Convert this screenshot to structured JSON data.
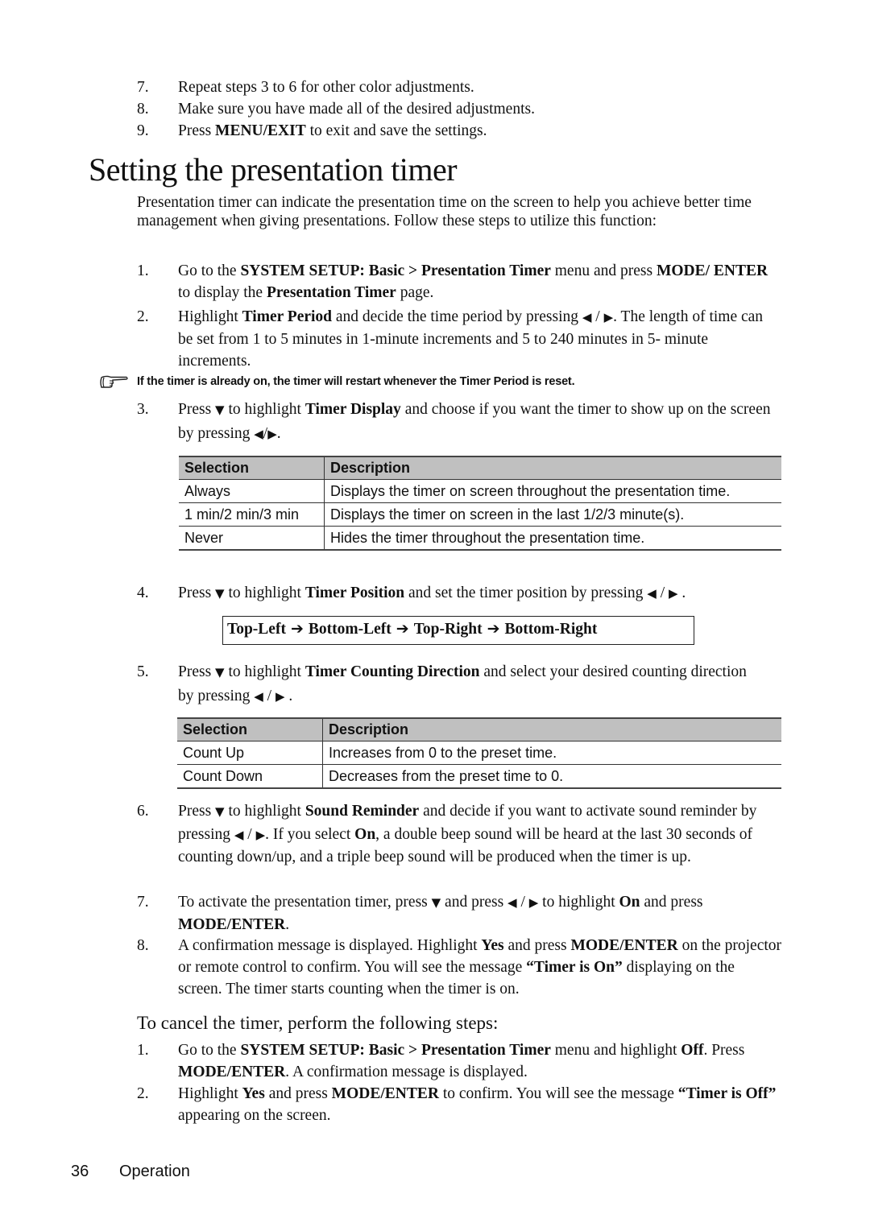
{
  "top_steps": [
    {
      "num": "7.",
      "parts": [
        {
          "t": "Repeat steps 3 to 6 for other color adjustments."
        }
      ]
    },
    {
      "num": "8.",
      "parts": [
        {
          "t": "Make sure you have made all of the desired adjustments."
        }
      ]
    },
    {
      "num": "9.",
      "parts": [
        {
          "t": "Press "
        },
        {
          "t": "MENU/EXIT",
          "b": true
        },
        {
          "t": " to exit and save the settings."
        }
      ]
    }
  ],
  "title": "Setting the presentation timer",
  "intro": "Presentation timer can indicate the presentation time on the screen to help you achieve better time management when giving presentations. Follow these steps to utilize this function:",
  "icons": {
    "left": "◀",
    "right": "▶",
    "down": "▼",
    "arrow": "➔",
    "note": "pointing-hand-icon"
  },
  "steps": [
    {
      "num": "1.",
      "parts": [
        {
          "t": "Go to the "
        },
        {
          "t": "SYSTEM SETUP: Basic > Presentation Timer",
          "b": true
        },
        {
          "t": " menu and press "
        },
        {
          "t": "MODE/ ENTER",
          "b": true
        },
        {
          "t": " to display the "
        },
        {
          "t": "Presentation Timer",
          "b": true
        },
        {
          "t": " page."
        }
      ]
    },
    {
      "num": "2.",
      "parts": [
        {
          "t": "Highlight "
        },
        {
          "t": "Timer Period",
          "b": true
        },
        {
          "t": " and decide the time period by pressing "
        },
        {
          "icon": "left"
        },
        {
          "t": " / "
        },
        {
          "icon": "right"
        },
        {
          "t": ". The length of time can be set from 1 to 5 minutes in 1-minute increments and 5 to 240 minutes in 5- minute increments."
        }
      ]
    },
    {
      "num": "3.",
      "parts": [
        {
          "t": "Press "
        },
        {
          "icon": "down"
        },
        {
          "t": " to highlight "
        },
        {
          "t": "Timer Display",
          "b": true
        },
        {
          "t": " and choose if you want the timer to show up on the screen by pressing "
        },
        {
          "icon": "left"
        },
        {
          "t": "/"
        },
        {
          "icon": "right"
        },
        {
          "t": "."
        }
      ]
    },
    {
      "num": "4.",
      "parts": [
        {
          "t": "Press "
        },
        {
          "icon": "down"
        },
        {
          "t": " to highlight "
        },
        {
          "t": "Timer Position",
          "b": true
        },
        {
          "t": " and set the timer position by pressing "
        },
        {
          "icon": "left"
        },
        {
          "t": " / "
        },
        {
          "icon": "right"
        },
        {
          "t": " ."
        }
      ]
    },
    {
      "num": "5.",
      "parts": [
        {
          "t": "Press "
        },
        {
          "icon": "down"
        },
        {
          "t": " to highlight "
        },
        {
          "t": "Timer Counting Direction",
          "b": true
        },
        {
          "t": " and select your desired counting direction by pressing "
        },
        {
          "icon": "left"
        },
        {
          "t": " / "
        },
        {
          "icon": "right"
        },
        {
          "t": " ."
        }
      ]
    },
    {
      "num": "6.",
      "parts": [
        {
          "t": "Press "
        },
        {
          "icon": "down"
        },
        {
          "t": " to highlight "
        },
        {
          "t": "Sound Reminder",
          "b": true
        },
        {
          "t": " and decide if you want to activate sound reminder by pressing "
        },
        {
          "icon": "left"
        },
        {
          "t": " / "
        },
        {
          "icon": "right"
        },
        {
          "t": ". If you select "
        },
        {
          "t": "On",
          "b": true
        },
        {
          "t": ", a double beep sound will be heard at the last 30 seconds of counting down/up, and a triple beep sound will be produced when the timer is up."
        }
      ]
    },
    {
      "num": "7.",
      "parts": [
        {
          "t": "To activate the presentation timer, press "
        },
        {
          "icon": "down"
        },
        {
          "t": " and press "
        },
        {
          "icon": "left"
        },
        {
          "t": " / "
        },
        {
          "icon": "right"
        },
        {
          "t": " to highlight "
        },
        {
          "t": "On",
          "b": true
        },
        {
          "t": " and press "
        },
        {
          "t": "MODE/ENTER",
          "b": true
        },
        {
          "t": "."
        }
      ]
    },
    {
      "num": "8.",
      "parts": [
        {
          "t": "A confirmation message is displayed. Highlight "
        },
        {
          "t": "Yes",
          "b": true
        },
        {
          "t": " and press "
        },
        {
          "t": "MODE/ENTER",
          "b": true
        },
        {
          "t": " on the projector or remote control to confirm. You will see the message "
        },
        {
          "t": "“Timer is On”",
          "b": true
        },
        {
          "t": " displaying on the screen. The timer starts counting when the timer is on."
        }
      ]
    }
  ],
  "note": "If the timer is already on, the timer will restart whenever the Timer Period is reset.",
  "display_table": {
    "headers": [
      "Selection",
      "Description"
    ],
    "rows": [
      [
        "Always",
        "Displays the timer on screen throughout the presentation time."
      ],
      [
        "1 min/2 min/3 min",
        "Displays the timer on screen in the last 1/2/3 minute(s)."
      ],
      [
        "Never",
        "Hides the timer throughout the presentation time."
      ]
    ]
  },
  "positions": [
    "Top-Left",
    "Bottom-Left",
    "Top-Right",
    "Bottom-Right"
  ],
  "direction_table": {
    "headers": [
      "Selection",
      "Description"
    ],
    "rows": [
      [
        "Count Up",
        "Increases from 0 to the preset time."
      ],
      [
        "Count Down",
        "Decreases from the preset time to 0."
      ]
    ]
  },
  "cancel_heading": "To cancel the timer, perform the following steps:",
  "cancel_steps": [
    {
      "num": "1.",
      "parts": [
        {
          "t": "Go to the "
        },
        {
          "t": "SYSTEM SETUP: Basic > Presentation Timer",
          "b": true
        },
        {
          "t": " menu and highlight "
        },
        {
          "t": "Off",
          "b": true
        },
        {
          "t": ". Press "
        },
        {
          "t": "MODE/ENTER",
          "b": true
        },
        {
          "t": ". A confirmation message is displayed."
        }
      ]
    },
    {
      "num": "2.",
      "parts": [
        {
          "t": "Highlight "
        },
        {
          "t": "Yes",
          "b": true
        },
        {
          "t": " and press "
        },
        {
          "t": "MODE/ENTER",
          "b": true
        },
        {
          "t": " to confirm. You will see the message "
        },
        {
          "t": "“Timer is Off”",
          "b": true
        },
        {
          "t": " appearing on the screen."
        }
      ]
    }
  ],
  "footer": {
    "page_number": "36",
    "section": "Operation"
  }
}
